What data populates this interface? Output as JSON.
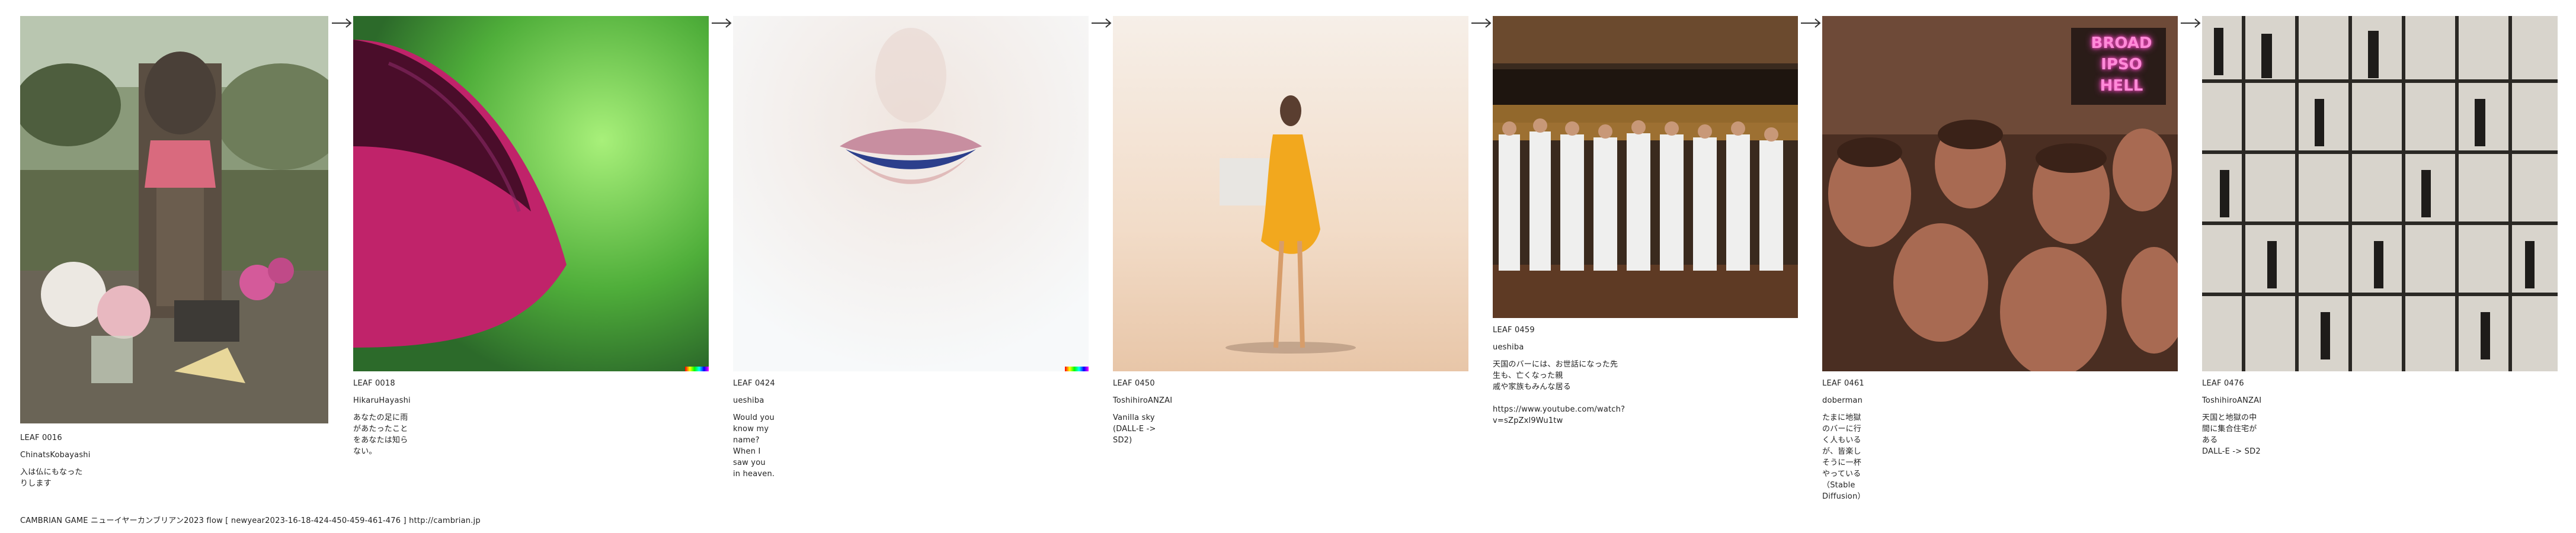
{
  "leaves": [
    {
      "id": "LEAF 0016",
      "author": "ChinatsKobayashi",
      "text": "入は仏にもなったりします",
      "image_desc": "stone-jizo-icon"
    },
    {
      "id": "LEAF 0018",
      "author": "HikaruHayashi",
      "text": "あなたの足に雨があたったことをあなたは知らない。",
      "image_desc": "petal-icon"
    },
    {
      "id": "LEAF 0424",
      "author": "ueshiba",
      "text": "Would you know my name?\nWhen I saw you in heaven.",
      "image_desc": "lips-icon"
    },
    {
      "id": "LEAF 0450",
      "author": "ToshihiroANZAI",
      "text": "Vanilla sky\n(DALL-E -> SD2)",
      "image_desc": "dress-figure-icon"
    },
    {
      "id": "LEAF 0459",
      "author": "ueshiba",
      "text": "天国のバーには、お世話になった先生も、亡くなった親\n戚や家族もみんな居る\n\nhttps://www.youtube.com/watch?v=sZpZxl9Wu1tw",
      "image_desc": "bar-group-icon"
    },
    {
      "id": "LEAF 0461",
      "author": "doberman",
      "text": "たまに地獄のバーに行く人もいるが、皆楽しそうに一杯\nやっている（Stable Diffusion）",
      "image_desc": "crowd-icon"
    },
    {
      "id": "LEAF 0476",
      "author": "ToshihiroANZAI",
      "text": "天国と地獄の中間に集合住宅がある\nDALL-E -> SD2",
      "image_desc": "grid-figures-icon"
    }
  ],
  "footer": {
    "title": "CAMBRIAN GAME  ニューイヤーカンブリアン2023  flow [ newyear2023-16-18-424-450-459-461-476 ]    http://cambrian.jp"
  },
  "neon_sign": "BROAD\nIPSO\nHELL"
}
